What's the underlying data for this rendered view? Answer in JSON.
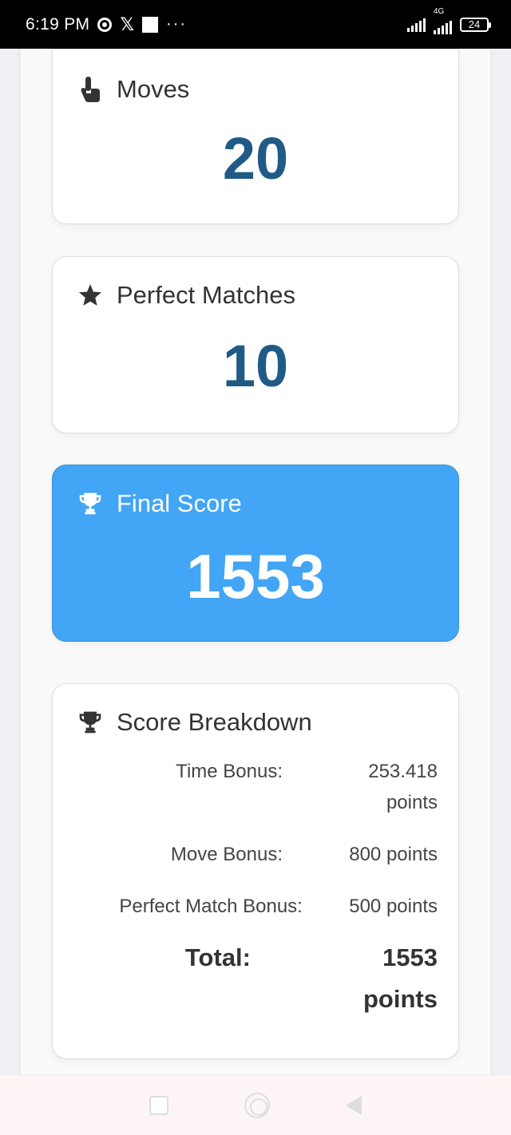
{
  "status_bar": {
    "time": "6:19 PM",
    "network_label": "4G",
    "battery": "24"
  },
  "moves": {
    "label": "Moves",
    "value": "20",
    "icon": "pointer-hand-icon"
  },
  "perfect_matches": {
    "label": "Perfect Matches",
    "value": "10",
    "icon": "star-icon"
  },
  "final_score": {
    "label": "Final Score",
    "value": "1553",
    "icon": "trophy-icon",
    "color": "#42a5f5"
  },
  "breakdown": {
    "title": "Score Breakdown",
    "icon": "trophy-icon",
    "rows": [
      {
        "label": "Time Bonus:",
        "value_line1": "253.418",
        "value_line2": "points"
      },
      {
        "label": "Move Bonus:",
        "value": "800 points"
      },
      {
        "label": "Perfect Match Bonus:",
        "value": "500 points"
      }
    ],
    "total": {
      "label": "Total:",
      "value_line1": "1553",
      "value_line2": "points"
    }
  },
  "colors": {
    "value_text": "#1f5b86",
    "final_card": "#42a5f5"
  }
}
